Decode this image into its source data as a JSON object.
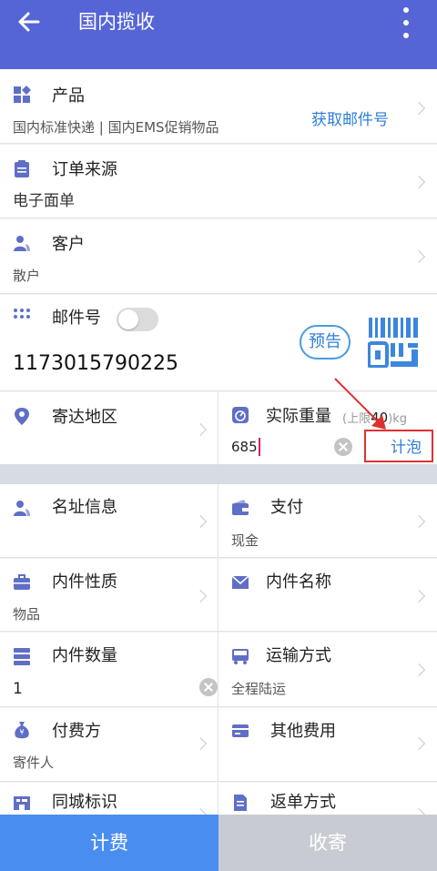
{
  "header": {
    "title": "国内揽收"
  },
  "product": {
    "label": "产品",
    "value": "国内标准快递 | 国内EMS促销物品",
    "action": "获取邮件号"
  },
  "order_source": {
    "label": "订单来源",
    "value": "电子面单"
  },
  "customer": {
    "label": "客户",
    "value": "散户"
  },
  "mail_no": {
    "label": "邮件号",
    "value": "1173015790225",
    "notice_button": "预告"
  },
  "region": {
    "label": "寄达地区"
  },
  "weight": {
    "label": "实际重量",
    "limit_hint_prefix": "(上限",
    "limit_value": "40",
    "limit_unit": ")kg",
    "value": "685",
    "action": "计泡"
  },
  "address_info": {
    "label": "名址信息"
  },
  "payment": {
    "label": "支付",
    "value": "现金"
  },
  "content_nature": {
    "label": "内件性质",
    "value": "物品"
  },
  "content_name": {
    "label": "内件名称"
  },
  "content_count": {
    "label": "内件数量",
    "value": "1"
  },
  "transport": {
    "label": "运输方式",
    "value": "全程陆运"
  },
  "payer": {
    "label": "付费方",
    "value": "寄件人"
  },
  "other_fees": {
    "label": "其他费用"
  },
  "same_city": {
    "label": "同城标识"
  },
  "return_method": {
    "label": "返单方式"
  },
  "footer": {
    "calc_fee": "计费",
    "receive": "收寄"
  },
  "colors": {
    "header": "#5665d6",
    "accent_blue": "#4a8df0",
    "highlight_red": "#d33"
  },
  "icons": [
    "back-arrow-icon",
    "more-vertical-icon",
    "product-grid-icon",
    "clipboard-icon",
    "person-icon",
    "dots-grid-icon",
    "barcode-scan-icon",
    "location-pin-icon",
    "scale-icon",
    "wallet-icon",
    "briefcase-icon",
    "envelope-icon",
    "stack-icon",
    "truck-icon",
    "money-bag-icon",
    "card-icon",
    "shop-icon",
    "document-icon",
    "chevron-right-icon",
    "clear-icon",
    "red-arrow-icon"
  ]
}
